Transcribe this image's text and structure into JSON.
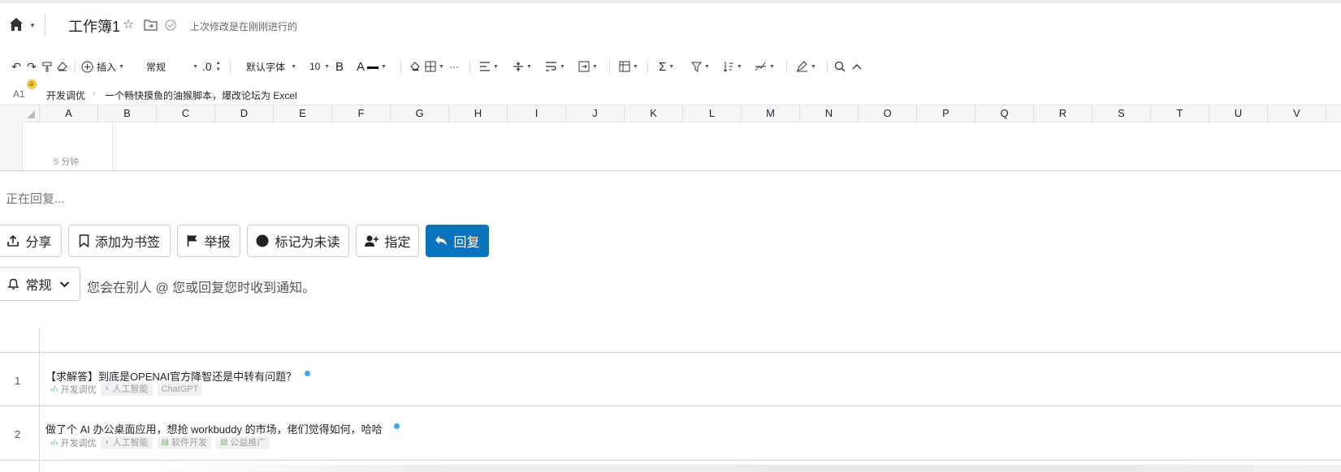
{
  "header": {
    "title": "工作簿1",
    "saved_status": "上次修改是在刚刚进行的"
  },
  "toolbar": {
    "insert_label": "插入",
    "number_format": "常规",
    "decimal_label": ".0",
    "font_name": "默认字体",
    "font_size": "10",
    "bold_label": "B",
    "text_color_label": "A",
    "more_label": "···"
  },
  "formula_bar": {
    "cell_ref": "A1",
    "category": "开发调优",
    "separator": "›",
    "topic": "一个畅快摸鱼的油猴脚本，爆改论坛为 Excel"
  },
  "grid": {
    "columns": [
      "A",
      "B",
      "C",
      "D",
      "E",
      "F",
      "G",
      "H",
      "I",
      "J",
      "K",
      "L",
      "M",
      "N",
      "O",
      "P",
      "Q",
      "R",
      "S",
      "T",
      "U",
      "V"
    ],
    "cell_text": "5 分钟"
  },
  "reply": {
    "status": "正在回复...",
    "buttons": {
      "share": "分享",
      "bookmark": "添加为书签",
      "flag": "举报",
      "mark_unread": "标记为未读",
      "assign": "指定",
      "reply": "回复"
    },
    "notification": {
      "level": "常规",
      "description": "您会在别人 @ 您或回复您时收到通知。"
    }
  },
  "topics": [
    {
      "num": "1",
      "title": "【求解答】到底是OPENAI官方降智还是中转有问题？",
      "category": "开发调优",
      "tags": [
        "人工智能",
        "ChatGPT"
      ]
    },
    {
      "num": "2",
      "title": "做了个 AI 办公桌面应用，想抢 workbuddy 的市场，佬们觉得如何，哈哈",
      "category": "开发调优",
      "tags": [
        "人工智能",
        "软件开发",
        "公益推广"
      ]
    }
  ],
  "colors": {
    "accent": "#0a73c0",
    "unread_dot": "#3aa8f0",
    "category_icon": "#58b6a8"
  }
}
